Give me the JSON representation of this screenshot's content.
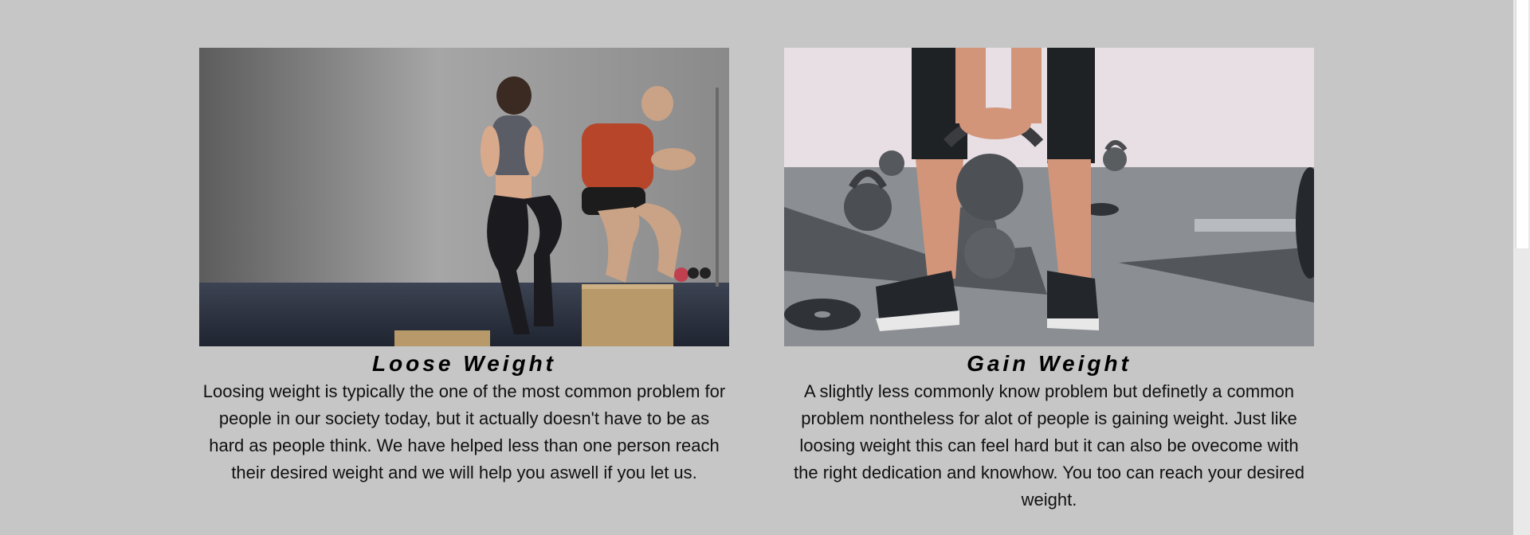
{
  "cards": [
    {
      "title": "Loose Weight",
      "description": "Loosing weight is typically the one of the most common problem for people in our society today, but it actually doesn't have to be as hard as people think. We have helped less than one person reach their desired weight and we will help you aswell if you let us.",
      "image_subject": "two people doing box jumps in a gym"
    },
    {
      "title": "Gain Weight",
      "description": "A slightly less commonly know problem but definetly a common problem nontheless for alot of people is gaining weight. Just like loosing weight this can feel hard but it can also be ovecome with the right dedication and knowhow. You too can reach your desired weight.",
      "image_subject": "person lifting a kettlebell with weights on the ground"
    }
  ],
  "colors": {
    "background": "#c6c6c6",
    "text": "#111111"
  }
}
